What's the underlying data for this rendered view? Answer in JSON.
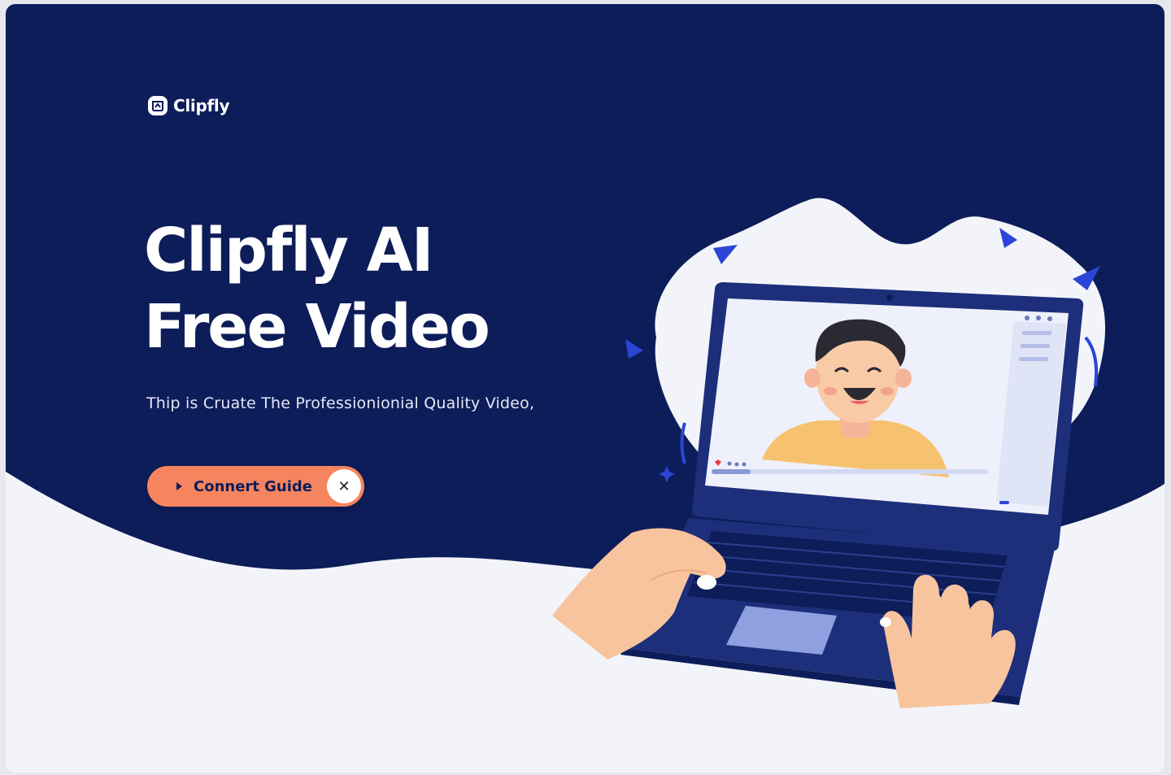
{
  "brand": {
    "name": "Clipfly",
    "logo_icon": "clipfly-logo-icon"
  },
  "hero": {
    "title_line1": "Clipfly AI",
    "title_line2": "Free Video",
    "tagline": "Thip is Cruate The Professionionial Quality Video,"
  },
  "cta": {
    "label": "Connert Guide",
    "play_icon": "play-icon",
    "close_icon": "close-icon",
    "close_glyph": "✕"
  },
  "colors": {
    "navy": "#0d1d59",
    "accent_orange": "#f5845f",
    "light_bg": "#f2f4f9",
    "white": "#ffffff"
  }
}
